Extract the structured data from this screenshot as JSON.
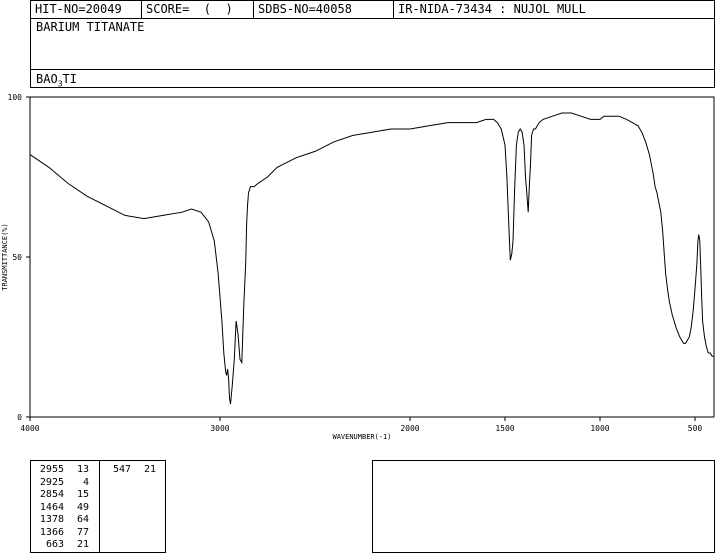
{
  "header": {
    "hit_no": "HIT-NO=20049",
    "score": "SCORE=  (  )",
    "sdbs_no": "SDBS-NO=40058",
    "ir_nida": "IR-NIDA-73434 : NUJOL MULL"
  },
  "compound": {
    "name": "BARIUM TITANATE",
    "formula_parts": [
      "BAO",
      "3",
      "TI"
    ]
  },
  "chart_data": {
    "type": "line",
    "title": "",
    "xlabel": "WAVENUMBER(-1)",
    "ylabel": "TRANSMITTANCE(%)",
    "xlim": [
      4000,
      400
    ],
    "ylim": [
      0,
      100
    ],
    "x_ticks": [
      4000,
      3000,
      2000,
      1500,
      1000,
      500
    ],
    "y_ticks": [
      0,
      50,
      100
    ],
    "grid": false,
    "color": "#000000",
    "series": [
      {
        "x": [
          4000,
          3900,
          3800,
          3700,
          3600,
          3500,
          3400,
          3300,
          3200,
          3150,
          3100,
          3060,
          3030,
          3010,
          2990,
          2980,
          2970,
          2965,
          2960,
          2955,
          2950,
          2945,
          2935,
          2925,
          2915,
          2905,
          2895,
          2885,
          2875,
          2865,
          2860,
          2855,
          2850,
          2845,
          2840,
          2830,
          2820,
          2800,
          2750,
          2700,
          2600,
          2500,
          2400,
          2300,
          2200,
          2100,
          2000,
          1900,
          1800,
          1700,
          1650,
          1600,
          1580,
          1560,
          1540,
          1520,
          1500,
          1490,
          1480,
          1472,
          1464,
          1458,
          1450,
          1440,
          1430,
          1420,
          1410,
          1400,
          1392,
          1385,
          1378,
          1372,
          1366,
          1360,
          1350,
          1340,
          1330,
          1320,
          1300,
          1250,
          1200,
          1150,
          1100,
          1050,
          1000,
          980,
          950,
          900,
          860,
          830,
          800,
          780,
          760,
          740,
          730,
          720,
          710,
          700,
          690,
          680,
          670,
          663,
          655,
          645,
          635,
          620,
          600,
          580,
          560,
          550,
          540,
          530,
          520,
          510,
          500,
          490,
          485,
          480,
          475,
          470,
          465,
          460,
          450,
          440,
          430,
          420,
          410,
          400
        ],
        "y": [
          82,
          78,
          73,
          69,
          66,
          63,
          62,
          63,
          64,
          65,
          64,
          61,
          55,
          45,
          30,
          20,
          14,
          13,
          15,
          12,
          6,
          4,
          10,
          18,
          30,
          26,
          18,
          17,
          35,
          48,
          60,
          66,
          70,
          71,
          72,
          72,
          72,
          73,
          75,
          78,
          81,
          83,
          86,
          88,
          89,
          90,
          90,
          91,
          92,
          92,
          92,
          93,
          93,
          93,
          92,
          90,
          85,
          75,
          60,
          49,
          51,
          55,
          70,
          85,
          89,
          90,
          89,
          85,
          75,
          70,
          64,
          72,
          79,
          88,
          90,
          90,
          91,
          92,
          93,
          94,
          95,
          95,
          94,
          93,
          93,
          94,
          94,
          94,
          93,
          92,
          91,
          89,
          86,
          82,
          79,
          76,
          72,
          70,
          67,
          64,
          58,
          52,
          45,
          40,
          36,
          32,
          28,
          25,
          23,
          23,
          24,
          25,
          28,
          33,
          40,
          48,
          55,
          57,
          55,
          47,
          38,
          30,
          25,
          22,
          20,
          20,
          19,
          19
        ]
      }
    ],
    "peaks_table": {
      "col1": [
        [
          "2955",
          "13"
        ],
        [
          "2925",
          "4"
        ],
        [
          "2854",
          "15"
        ],
        [
          "1464",
          "49"
        ],
        [
          "1378",
          "64"
        ],
        [
          "1366",
          "77"
        ],
        [
          "663",
          "21"
        ]
      ],
      "col2": [
        [
          "547",
          "21"
        ]
      ]
    }
  }
}
